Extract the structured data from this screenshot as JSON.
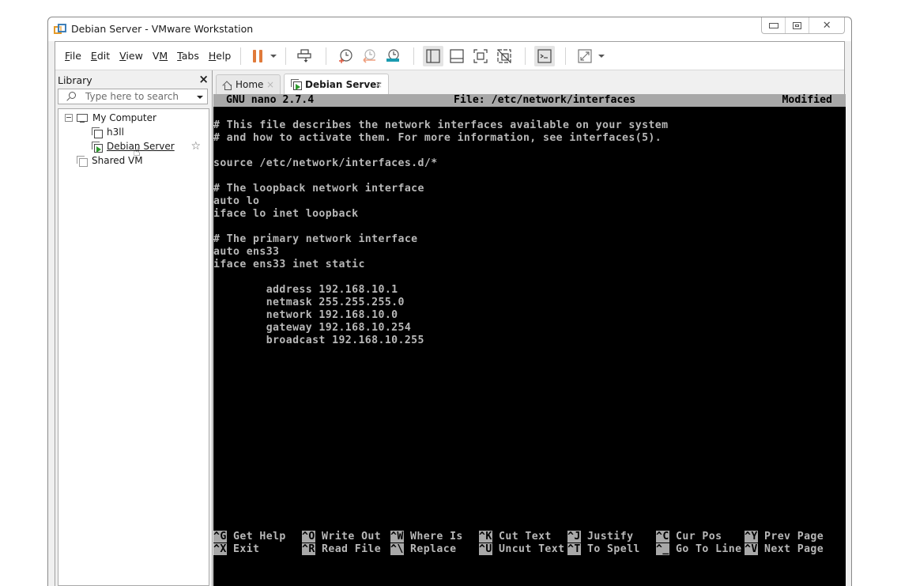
{
  "window": {
    "title": "Debian Server - VMware Workstation",
    "controls": {
      "minimize": "minimize",
      "restore": "restore",
      "close": "close"
    }
  },
  "menu": [
    {
      "label": "File",
      "mnemonic": "F",
      "rest": "ile"
    },
    {
      "label": "Edit",
      "mnemonic": "E",
      "rest": "dit"
    },
    {
      "label": "View",
      "mnemonic": "V",
      "rest": "iew"
    },
    {
      "label": "VM",
      "mnemonic": "V",
      "rest": "M"
    },
    {
      "label": "Tabs",
      "mnemonic": "T",
      "rest": "abs"
    },
    {
      "label": "Help",
      "mnemonic": "H",
      "rest": "elp"
    }
  ],
  "toolbar": {
    "icons": [
      "pause-icon",
      "send-ctrl-alt-del-icon",
      "take-snapshot-icon",
      "revert-snapshot-icon",
      "snapshot-manager-icon",
      "show-library-icon",
      "thumbnail-bar-icon",
      "full-screen-icon",
      "unity-icon",
      "console-view-icon",
      "stretch-guest-icon"
    ],
    "colors": {
      "pause": "#e07a3a",
      "snapshot_take": "#e0543a",
      "snapshot_revert": "#f0a080",
      "snapshot_manager": "#1a9bb0"
    }
  },
  "library": {
    "title": "Library",
    "close": "×",
    "search_placeholder": "Type here to search",
    "tree": [
      {
        "label": "My Computer",
        "level": 0,
        "type": "computer",
        "expanded": true
      },
      {
        "label": "h3ll",
        "level": 1,
        "type": "vm"
      },
      {
        "label": "Debian Server",
        "level": 1,
        "type": "vm-running",
        "selected": true,
        "favorite": "☆"
      },
      {
        "label": "Shared VMs",
        "display": "Shared VM",
        "level": 0,
        "type": "shared"
      }
    ]
  },
  "tabs": [
    {
      "label": "Home",
      "close": "×",
      "active": false
    },
    {
      "label": "Debian Server",
      "close": "×",
      "active": true
    }
  ],
  "console": {
    "header": {
      "app": "GNU nano 2.7.4",
      "file": "File: /etc/network/interfaces",
      "status": "Modified"
    },
    "lines": [
      "# This file describes the network interfaces available on your system",
      "# and how to activate them. For more information, see interfaces(5).",
      "",
      "source /etc/network/interfaces.d/*",
      "",
      "# The loopback network interface",
      "auto lo",
      "iface lo inet loopback",
      "",
      "# The primary network interface",
      "auto ens33",
      "iface ens33 inet static",
      "",
      "        address 192.168.10.1",
      "        netmask 255.255.255.0",
      "        network 192.168.10.0",
      "        gateway 192.168.10.254",
      "        broadcast 192.168.10.255"
    ],
    "shortcuts": [
      [
        {
          "key": "^G",
          "label": "Get Help"
        },
        {
          "key": "^O",
          "label": "Write Out"
        },
        {
          "key": "^W",
          "label": "Where Is"
        },
        {
          "key": "^K",
          "label": "Cut Text"
        },
        {
          "key": "^J",
          "label": "Justify"
        },
        {
          "key": "^C",
          "label": "Cur Pos"
        },
        {
          "key": "^Y",
          "label": "Prev Page"
        }
      ],
      [
        {
          "key": "^X",
          "label": "Exit"
        },
        {
          "key": "^R",
          "label": "Read File"
        },
        {
          "key": "^\\",
          "label": "Replace"
        },
        {
          "key": "^U",
          "label": "Uncut Text"
        },
        {
          "key": "^T",
          "label": "To Spell"
        },
        {
          "key": "^_",
          "label": "Go To Line"
        },
        {
          "key": "^V",
          "label": "Next Page"
        }
      ]
    ]
  }
}
